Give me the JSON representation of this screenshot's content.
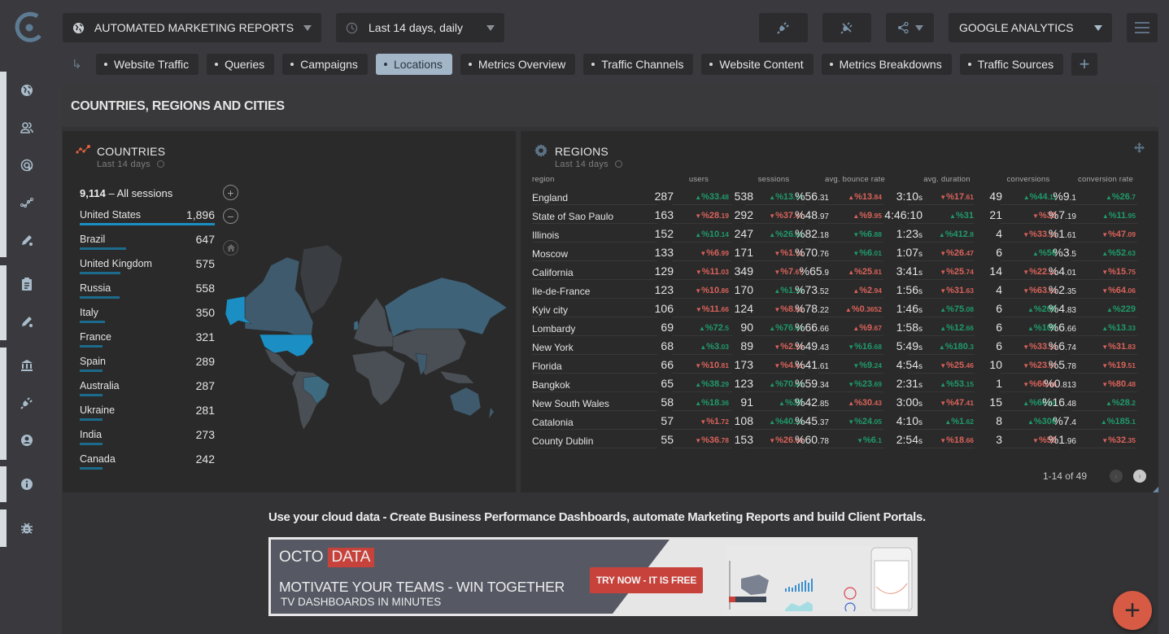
{
  "header": {
    "report_selector": "AUTOMATED MARKETING REPORTS",
    "date_selector": "Last 14 days, daily",
    "datasource_selector": "GOOGLE ANALYTICS"
  },
  "tabs": [
    {
      "label": "Website Traffic",
      "active": false
    },
    {
      "label": "Queries",
      "active": false
    },
    {
      "label": "Campaigns",
      "active": false
    },
    {
      "label": "Locations",
      "active": true
    },
    {
      "label": "Metrics Overview",
      "active": false
    },
    {
      "label": "Traffic Channels",
      "active": false
    },
    {
      "label": "Website Content",
      "active": false
    },
    {
      "label": "Metrics Breakdowns",
      "active": false
    },
    {
      "label": "Traffic Sources",
      "active": false
    }
  ],
  "sidebar": {
    "icons": [
      "globe-icon",
      "users-icon",
      "target-icon",
      "analytics-icon",
      "edit-icon",
      "clipboard-icon",
      "edit-icon",
      "bank-icon",
      "plug-icon",
      "account-icon",
      "info-icon",
      "bug-icon"
    ]
  },
  "page_title": "COUNTRIES, REGIONS AND CITIES",
  "countries": {
    "title": "COUNTRIES",
    "subtitle": "Last 14 days",
    "total_value": "9,114",
    "total_label": "– All sessions",
    "items": [
      {
        "name": "United States",
        "value": "1,896",
        "share": 1.0
      },
      {
        "name": "Brazil",
        "value": "647",
        "share": 0.341
      },
      {
        "name": "United Kingdom",
        "value": "575",
        "share": 0.303
      },
      {
        "name": "Russia",
        "value": "558",
        "share": 0.294
      },
      {
        "name": "Italy",
        "value": "350",
        "share": 0.185
      },
      {
        "name": "France",
        "value": "321",
        "share": 0.169
      },
      {
        "name": "Spain",
        "value": "289",
        "share": 0.152
      },
      {
        "name": "Australia",
        "value": "287",
        "share": 0.151
      },
      {
        "name": "Ukraine",
        "value": "281",
        "share": 0.148
      },
      {
        "name": "India",
        "value": "273",
        "share": 0.144
      },
      {
        "name": "Canada",
        "value": "242",
        "share": 0.128
      }
    ],
    "map_colors": {
      "highest": "#1b8fc4",
      "high": "#3d6278",
      "none": "#4a4f55"
    }
  },
  "regions": {
    "title": "REGIONS",
    "subtitle": "Last 14 days",
    "columns": [
      "region",
      "users",
      "sessions",
      "avg. bounce rate",
      "avg. duration",
      "conversions",
      "conversion rate"
    ],
    "rows": [
      {
        "region": "England",
        "users": "287",
        "users_chg": "%33.48",
        "users_dir": "up",
        "sessions": "538",
        "sessions_chg": "%13.74",
        "sessions_dir": "up",
        "bounce": "%56.31",
        "bounce_chg": "%13.84",
        "bounce_dir": "up-bad",
        "duration": "3:10s",
        "duration_chg": "%17.61",
        "duration_dir": "dn",
        "conv": "49",
        "conv_chg": "%44.11",
        "conv_dir": "up",
        "rate": "%9.1",
        "rate_chg": "%26.7",
        "rate_dir": "up"
      },
      {
        "region": "State of Sao Paulo",
        "users": "163",
        "users_chg": "%28.19",
        "users_dir": "dn",
        "sessions": "292",
        "sessions_chg": "%37.47",
        "sessions_dir": "dn",
        "bounce": "%48.97",
        "bounce_chg": "%9.95",
        "bounce_dir": "up-bad",
        "duration": "4:46:10",
        "duration_chg": "%31",
        "duration_dir": "up",
        "conv": "21",
        "conv_chg": "%30",
        "conv_dir": "dn",
        "rate": "%7.19",
        "rate_chg": "%11.95",
        "rate_dir": "up"
      },
      {
        "region": "Illinois",
        "users": "152",
        "users_chg": "%10.14",
        "users_dir": "up",
        "sessions": "247",
        "sessions_chg": "%26.02",
        "sessions_dir": "up",
        "bounce": "%82.18",
        "bounce_chg": "%6.88",
        "bounce_dir": "dn-good",
        "duration": "1:23s",
        "duration_chg": "%412.8",
        "duration_dir": "up",
        "conv": "4",
        "conv_chg": "%33.33",
        "conv_dir": "dn",
        "rate": "%1.61",
        "rate_chg": "%47.09",
        "rate_dir": "dn"
      },
      {
        "region": "Moscow",
        "users": "133",
        "users_chg": "%6.99",
        "users_dir": "dn",
        "sessions": "171",
        "sessions_chg": "%1.72",
        "sessions_dir": "dn",
        "bounce": "%70.76",
        "bounce_chg": "%6.01",
        "bounce_dir": "dn-good",
        "duration": "1:07s",
        "duration_chg": "%26.47",
        "duration_dir": "dn",
        "conv": "6",
        "conv_chg": "%50",
        "conv_dir": "up",
        "rate": "%3.5",
        "rate_chg": "%52.63",
        "rate_dir": "up"
      },
      {
        "region": "California",
        "users": "129",
        "users_chg": "%11.03",
        "users_dir": "dn",
        "sessions": "349",
        "sessions_chg": "%7.67",
        "sessions_dir": "dn",
        "bounce": "%65.9",
        "bounce_chg": "%25.81",
        "bounce_dir": "up-bad",
        "duration": "3:41s",
        "duration_chg": "%25.74",
        "duration_dir": "dn",
        "conv": "14",
        "conv_chg": "%22.22",
        "conv_dir": "dn",
        "rate": "%4.01",
        "rate_chg": "%15.75",
        "rate_dir": "dn"
      },
      {
        "region": "Ile-de-France",
        "users": "123",
        "users_chg": "%10.86",
        "users_dir": "dn",
        "sessions": "170",
        "sessions_chg": "%1.19",
        "sessions_dir": "up",
        "bounce": "%73.52",
        "bounce_chg": "%2.94",
        "bounce_dir": "up-bad",
        "duration": "1:56s",
        "duration_chg": "%31.63",
        "duration_dir": "dn",
        "conv": "4",
        "conv_chg": "%63.63",
        "conv_dir": "dn",
        "rate": "%2.35",
        "rate_chg": "%64.06",
        "rate_dir": "dn"
      },
      {
        "region": "Kyiv city",
        "users": "106",
        "users_chg": "%11.66",
        "users_dir": "dn",
        "sessions": "124",
        "sessions_chg": "%8.82",
        "sessions_dir": "dn",
        "bounce": "%78.22",
        "bounce_chg": "%0.3652",
        "bounce_dir": "up-bad",
        "duration": "1:46s",
        "duration_chg": "%75.08",
        "duration_dir": "up",
        "conv": "6",
        "conv_chg": "%200",
        "conv_dir": "up",
        "rate": "%4.83",
        "rate_chg": "%229",
        "rate_dir": "up"
      },
      {
        "region": "Lombardy",
        "users": "69",
        "users_chg": "%72.5",
        "users_dir": "up",
        "sessions": "90",
        "sessions_chg": "%76.47",
        "sessions_dir": "up",
        "bounce": "%66.66",
        "bounce_chg": "%9.67",
        "bounce_dir": "up-bad",
        "duration": "1:58s",
        "duration_chg": "%12.66",
        "duration_dir": "up",
        "conv": "6",
        "conv_chg": "%100",
        "conv_dir": "up",
        "rate": "%6.66",
        "rate_chg": "%13.33",
        "rate_dir": "up"
      },
      {
        "region": "New York",
        "users": "68",
        "users_chg": "%3.03",
        "users_dir": "up",
        "sessions": "89",
        "sessions_chg": "%2.19",
        "sessions_dir": "dn",
        "bounce": "%49.43",
        "bounce_chg": "%16.68",
        "bounce_dir": "dn-good",
        "duration": "5:49s",
        "duration_chg": "%180.3",
        "duration_dir": "up",
        "conv": "6",
        "conv_chg": "%33.33",
        "conv_dir": "dn",
        "rate": "%6.74",
        "rate_chg": "%31.83",
        "rate_dir": "dn"
      },
      {
        "region": "Florida",
        "users": "66",
        "users_chg": "%10.81",
        "users_dir": "dn",
        "sessions": "173",
        "sessions_chg": "%4.41",
        "sessions_dir": "dn",
        "bounce": "%41.61",
        "bounce_chg": "%9.24",
        "bounce_dir": "dn-good",
        "duration": "4:54s",
        "duration_chg": "%25.46",
        "duration_dir": "dn",
        "conv": "10",
        "conv_chg": "%23.07",
        "conv_dir": "dn",
        "rate": "%5.78",
        "rate_chg": "%19.51",
        "rate_dir": "dn"
      },
      {
        "region": "Bangkok",
        "users": "65",
        "users_chg": "%38.29",
        "users_dir": "up",
        "sessions": "123",
        "sessions_chg": "%70.83",
        "sessions_dir": "up",
        "bounce": "%59.34",
        "bounce_chg": "%23.69",
        "bounce_dir": "dn-good",
        "duration": "2:31s",
        "duration_chg": "%53.15",
        "duration_dir": "up",
        "conv": "1",
        "conv_chg": "%66.66",
        "conv_dir": "dn",
        "rate": "%0.813",
        "rate_chg": "%80.48",
        "rate_dir": "dn"
      },
      {
        "region": "New South Wales",
        "users": "58",
        "users_chg": "%18.36",
        "users_dir": "up",
        "sessions": "91",
        "sessions_chg": "%30",
        "sessions_dir": "up",
        "bounce": "%42.85",
        "bounce_chg": "%30.43",
        "bounce_dir": "up-bad",
        "duration": "3:00s",
        "duration_chg": "%47.41",
        "duration_dir": "dn",
        "conv": "15",
        "conv_chg": "%66.66",
        "conv_dir": "up",
        "rate": "%16.48",
        "rate_chg": "%28.2",
        "rate_dir": "up"
      },
      {
        "region": "Catalonia",
        "users": "57",
        "users_chg": "%1.72",
        "users_dir": "dn",
        "sessions": "108",
        "sessions_chg": "%40.25",
        "sessions_dir": "up",
        "bounce": "%45.37",
        "bounce_chg": "%24.05",
        "bounce_dir": "dn-good",
        "duration": "4:10s",
        "duration_chg": "%1.62",
        "duration_dir": "up",
        "conv": "8",
        "conv_chg": "%300",
        "conv_dir": "up",
        "rate": "%7.4",
        "rate_chg": "%185.1",
        "rate_dir": "up"
      },
      {
        "region": "County Dublin",
        "users": "55",
        "users_chg": "%36.78",
        "users_dir": "dn",
        "sessions": "153",
        "sessions_chg": "%26.08",
        "sessions_dir": "dn",
        "bounce": "%60.78",
        "bounce_chg": "%6.1",
        "bounce_dir": "dn-good",
        "duration": "2:54s",
        "duration_chg": "%18.66",
        "duration_dir": "dn",
        "conv": "3",
        "conv_chg": "%50",
        "conv_dir": "dn",
        "rate": "%1.96",
        "rate_chg": "%32.35",
        "rate_dir": "dn"
      }
    ],
    "pager": "1-14 of 49"
  },
  "promo": {
    "headline": "Use your cloud data - Create Business Performance Dashboards, automate Marketing Reports and build Client Portals.",
    "brand_left": "OCTO",
    "brand_right": "DATA",
    "tagline": "MOTIVATE YOUR TEAMS - WIN TOGETHER",
    "subtagline": "TV DASHBOARDS IN MINUTES",
    "cta": "TRY NOW - IT IS FREE"
  },
  "colors": {
    "accent_blue": "#1b8fc4",
    "positive": "#1f9a6a",
    "negative": "#d9625a",
    "fab": "#d65a44",
    "active_tab": "#a3b6c8"
  }
}
